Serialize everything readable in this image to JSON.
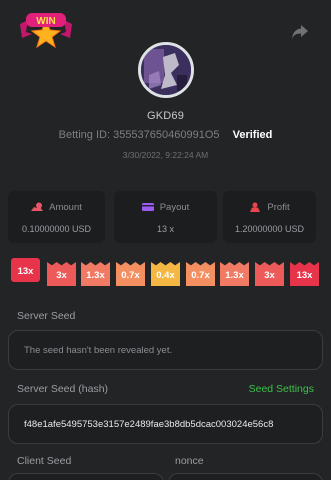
{
  "logo_text": "WIN",
  "user": {
    "name": "GKD69"
  },
  "bet": {
    "id_label": "Betting ID:",
    "id_value": "355537650460991O5",
    "verified": "Verified",
    "time": "3/30/2022, 9:22:24 AM"
  },
  "stats": {
    "amount": {
      "label": "Amount",
      "value": "0.10000000 USD",
      "icon": "coins-icon",
      "color": "#e8566a"
    },
    "payout": {
      "label": "Payout",
      "value": "13 x",
      "icon": "card-icon",
      "color": "#9b5cf0"
    },
    "profit": {
      "label": "Profit",
      "value": "1.20000000 USD",
      "icon": "money-bag-icon",
      "color": "#e8454f"
    }
  },
  "multipliers": [
    {
      "label": "13x",
      "color": "#e8344a",
      "selected": true
    },
    {
      "label": "3x",
      "color": "#ec5a5a"
    },
    {
      "label": "1.3x",
      "color": "#f07a64"
    },
    {
      "label": "0.7x",
      "color": "#f48f62"
    },
    {
      "label": "0.4x",
      "color": "#f5b743"
    },
    {
      "label": "0.7x",
      "color": "#f48f62"
    },
    {
      "label": "1.3x",
      "color": "#f07a64"
    },
    {
      "label": "3x",
      "color": "#ec5a5a"
    },
    {
      "label": "13x",
      "color": "#e8344a"
    }
  ],
  "server_seed": {
    "label": "Server Seed",
    "value": "The seed hasn't been revealed yet."
  },
  "server_seed_hash": {
    "label": "Server Seed (hash)",
    "settings_link": "Seed Settings",
    "value": "f48e1afe5495753e3157e2489fae3b8db5dcac003024e56c8"
  },
  "client_seed": {
    "label": "Client Seed"
  },
  "nonce": {
    "label": "nonce"
  }
}
